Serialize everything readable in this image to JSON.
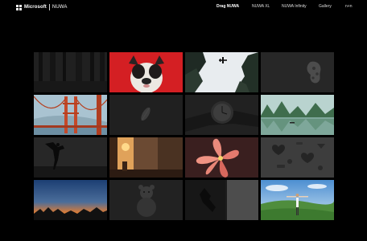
{
  "header": {
    "brand": "Microsoft",
    "product": "NUWA",
    "nav": [
      {
        "label": "Drag NUWA",
        "active": true
      },
      {
        "label": "NUWA XL",
        "active": false
      },
      {
        "label": "NUWA Infinity",
        "active": false
      },
      {
        "label": "Gallery",
        "active": false
      },
      {
        "label": "n+n",
        "active": false
      }
    ]
  },
  "gallery": {
    "tiles": [
      {
        "subject": "forest trees",
        "style": "grayscale"
      },
      {
        "subject": "french bulldog on red",
        "style": "color"
      },
      {
        "subject": "airplane over trees",
        "style": "color"
      },
      {
        "subject": "leaf figure",
        "style": "grayscale"
      },
      {
        "subject": "golden gate bridge",
        "style": "color"
      },
      {
        "subject": "feather",
        "style": "grayscale"
      },
      {
        "subject": "wrist watch",
        "style": "grayscale"
      },
      {
        "subject": "lake with karst hills",
        "style": "color"
      },
      {
        "subject": "dancer silhouette",
        "style": "grayscale"
      },
      {
        "subject": "street at sunset",
        "style": "color"
      },
      {
        "subject": "pink lily flower",
        "style": "color"
      },
      {
        "subject": "hearts and pieces",
        "style": "grayscale"
      },
      {
        "subject": "dusk skyline",
        "style": "color"
      },
      {
        "subject": "teddy bear",
        "style": "grayscale"
      },
      {
        "subject": "hand at window",
        "style": "grayscale"
      },
      {
        "subject": "man on green hill",
        "style": "color"
      }
    ]
  },
  "colors": {
    "background": "#000000",
    "text": "#ffffff"
  }
}
